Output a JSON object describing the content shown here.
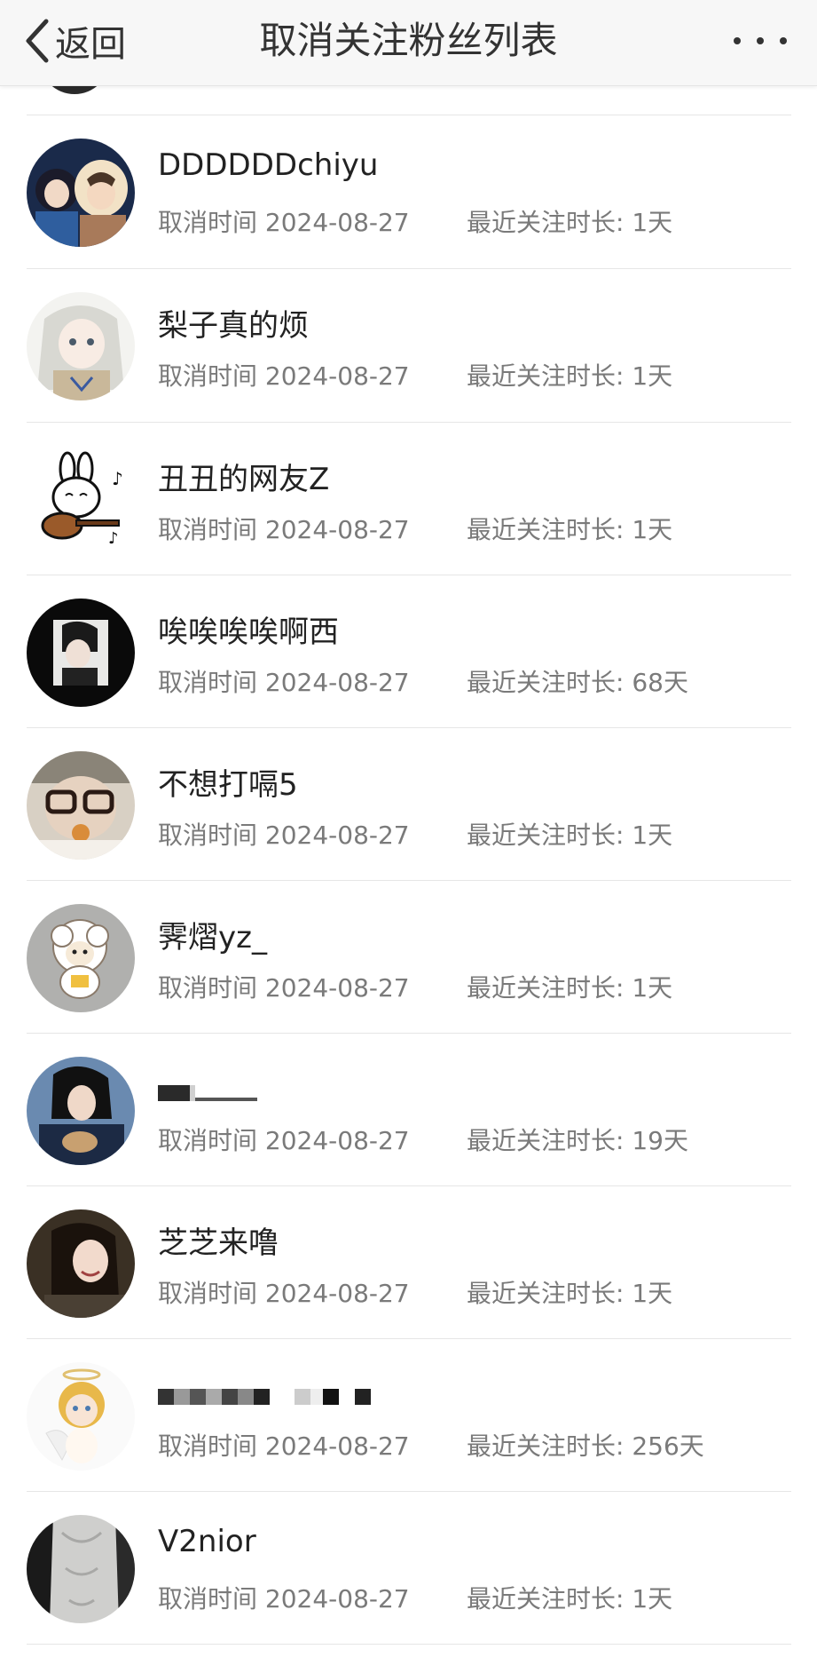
{
  "header": {
    "back_label": "返回",
    "title": "取消关注粉丝列表"
  },
  "items": [
    {
      "name": "DDDDDDchiyu",
      "date_text": "取消时间 2024-08-27",
      "duration_text": "最近关注时长: 1天",
      "avatar": "anime-couple-avatar"
    },
    {
      "name": "梨子真的烦",
      "date_text": "取消时间 2024-08-27",
      "duration_text": "最近关注时长: 1天",
      "avatar": "anime-girl-avatar"
    },
    {
      "name": "丑丑的网友Z",
      "date_text": "取消时间 2024-08-27",
      "duration_text": "最近关注时长: 1天",
      "avatar": "bunny-guitar-avatar"
    },
    {
      "name": "唉唉唉唉啊西",
      "date_text": "取消时间 2024-08-27",
      "duration_text": "最近关注时长: 68天",
      "avatar": "dark-portrait-avatar"
    },
    {
      "name": "不想打嗝5",
      "date_text": "取消时间 2024-08-27",
      "duration_text": "最近关注时长: 1天",
      "avatar": "glasses-photo-avatar"
    },
    {
      "name": "霁熠yz_",
      "date_text": "取消时间 2024-08-27",
      "duration_text": "最近关注时长: 1天",
      "avatar": "sheep-cartoon-avatar"
    },
    {
      "name": "",
      "date_text": "取消时间 2024-08-27",
      "duration_text": "最近关注时长: 19天",
      "avatar": "person-holding-pet-avatar",
      "name_redacted": true
    },
    {
      "name": "芝芝来噜",
      "date_text": "取消时间 2024-08-27",
      "duration_text": "最近关注时长: 1天",
      "avatar": "smiling-girl-avatar"
    },
    {
      "name": "",
      "date_text": "取消时间 2024-08-27",
      "duration_text": "最近关注时长: 256天",
      "avatar": "angel-doll-avatar",
      "name_redacted": true
    },
    {
      "name": "V2nior",
      "date_text": "取消时间 2024-08-27",
      "duration_text": "最近关注时长: 1天",
      "avatar": "gray-sculpture-avatar"
    }
  ]
}
